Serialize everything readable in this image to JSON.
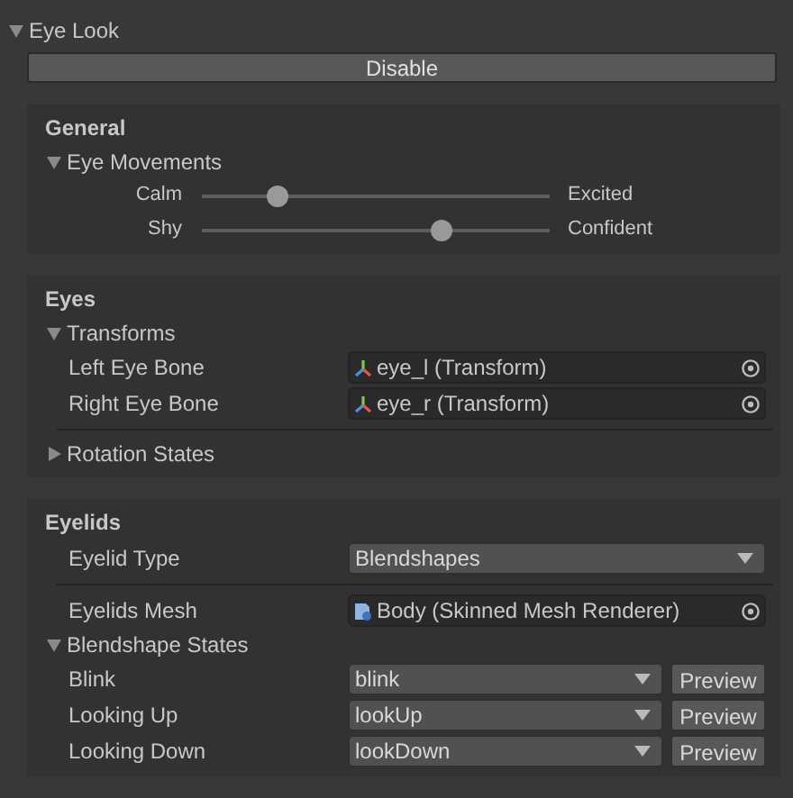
{
  "root": {
    "label": "Eye Look",
    "expanded": true
  },
  "toggle_button": "Disable",
  "sections": [
    {
      "title": "General",
      "items": [
        {
          "kind": "foldout",
          "label": "Eye Movements",
          "expanded": true,
          "children": [
            {
              "kind": "slider",
              "left_label": "Calm",
              "right_label": "Excited",
              "level": 0.22
            },
            {
              "kind": "slider",
              "left_label": "Shy",
              "right_label": "Confident",
              "level": 0.69
            }
          ]
        }
      ]
    },
    {
      "title": "Eyes",
      "items": [
        {
          "kind": "foldout",
          "label": "Transforms",
          "expanded": true,
          "children": [
            {
              "kind": "transform_field",
              "label": "Left Eye Bone",
              "value": "eye_l (Transform)"
            },
            {
              "kind": "transform_field",
              "label": "Right Eye Bone",
              "value": "eye_r (Transform)"
            },
            {
              "kind": "divider"
            }
          ]
        },
        {
          "kind": "foldout",
          "label": "Rotation States",
          "expanded": false
        }
      ]
    },
    {
      "title": "Eyelids",
      "items": [
        {
          "kind": "dropdown",
          "label": "Eyelid Type",
          "value": "Blendshapes"
        },
        {
          "kind": "divider"
        },
        {
          "kind": "mesh_field",
          "label": "Eyelids Mesh",
          "value": "Body (Skinned Mesh Renderer)"
        },
        {
          "kind": "foldout",
          "label": "Blendshape States",
          "expanded": true,
          "children": [
            {
              "kind": "dropdown_preview",
              "label": "Blink",
              "value": "blink",
              "button": "Preview"
            },
            {
              "kind": "dropdown_preview",
              "label": "Looking Up",
              "value": "lookUp",
              "button": "Preview"
            },
            {
              "kind": "dropdown_preview",
              "label": "Looking Down",
              "value": "lookDown",
              "button": "Preview"
            }
          ]
        }
      ]
    }
  ]
}
